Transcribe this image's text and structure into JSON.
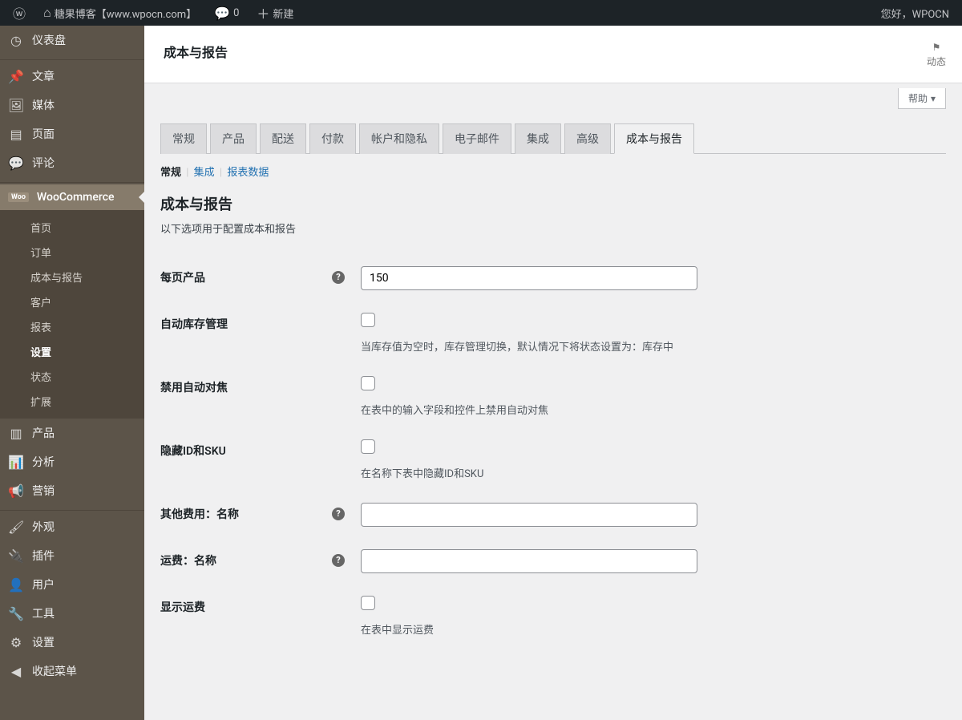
{
  "adminbar": {
    "site_title": "糖果博客【www.wpocn.com】",
    "comments": "0",
    "new": "新建",
    "greeting": "您好，WPOCN"
  },
  "page": {
    "title": "成本与报告",
    "activity_label": "动态",
    "help": "帮助"
  },
  "sidebar": {
    "items": [
      {
        "icon": "◷",
        "label": "仪表盘"
      },
      {
        "icon": "📌",
        "label": "文章"
      },
      {
        "icon": "🖼",
        "label": "媒体"
      },
      {
        "icon": "▤",
        "label": "页面"
      },
      {
        "icon": "💬",
        "label": "评论"
      }
    ],
    "woo_label": "WooCommerce",
    "woo_sub": [
      {
        "label": "首页"
      },
      {
        "label": "订单"
      },
      {
        "label": "成本与报告"
      },
      {
        "label": "客户"
      },
      {
        "label": "报表"
      },
      {
        "label": "设置",
        "current": true
      },
      {
        "label": "状态"
      },
      {
        "label": "扩展"
      }
    ],
    "items2": [
      {
        "icon": "▥",
        "label": "产品"
      },
      {
        "icon": "📊",
        "label": "分析"
      },
      {
        "icon": "📢",
        "label": "营销"
      }
    ],
    "items3": [
      {
        "icon": "🖌",
        "label": "外观"
      },
      {
        "icon": "🔌",
        "label": "插件"
      },
      {
        "icon": "👤",
        "label": "用户"
      },
      {
        "icon": "🔧",
        "label": "工具"
      },
      {
        "icon": "⚙",
        "label": "设置"
      },
      {
        "icon": "◀",
        "label": "收起菜单"
      }
    ]
  },
  "tabs": [
    {
      "label": "常规"
    },
    {
      "label": "产品"
    },
    {
      "label": "配送"
    },
    {
      "label": "付款"
    },
    {
      "label": "帐户和隐私"
    },
    {
      "label": "电子邮件"
    },
    {
      "label": "集成"
    },
    {
      "label": "高级"
    },
    {
      "label": "成本与报告",
      "active": true
    }
  ],
  "subtabs": {
    "current": "常规",
    "links": [
      "集成",
      "报表数据"
    ]
  },
  "section": {
    "title": "成本与报告",
    "desc": "以下选项用于配置成本和报告"
  },
  "fields": {
    "per_page": {
      "label": "每页产品",
      "value": "150"
    },
    "auto_stock": {
      "label": "自动库存管理",
      "desc": "当库存值为空时，库存管理切换，默认情况下将状态设置为：库存中"
    },
    "disable_autofocus": {
      "label": "禁用自动对焦",
      "desc": "在表中的输入字段和控件上禁用自动对焦"
    },
    "hide_id_sku": {
      "label": "隐藏ID和SKU",
      "desc": "在名称下表中隐藏ID和SKU"
    },
    "other_cost_name": {
      "label": "其他费用：名称",
      "value": ""
    },
    "shipping_name": {
      "label": "运费：名称",
      "value": ""
    },
    "show_shipping": {
      "label": "显示运费",
      "desc": "在表中显示运费"
    }
  }
}
